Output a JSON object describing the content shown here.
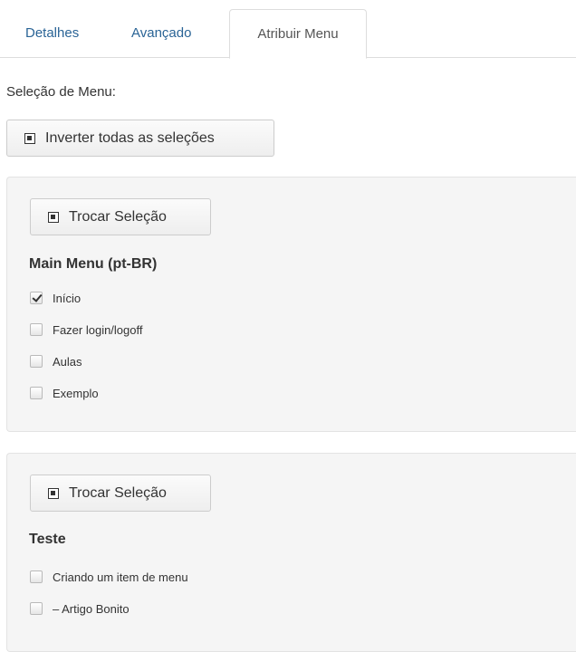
{
  "tabs": [
    {
      "label": "Detalhes",
      "active": false
    },
    {
      "label": "Avançado",
      "active": false
    },
    {
      "label": "Atribuir Menu",
      "active": true
    }
  ],
  "menu_selection": {
    "label": "Seleção de Menu:",
    "invert_button_label": "Inverter todas as seleções"
  },
  "groups": [
    {
      "toggle_label": "Trocar Seleção",
      "title": "Main Menu (pt-BR)",
      "items": [
        {
          "label": "Início",
          "checked": true
        },
        {
          "label": "Fazer login/logoff",
          "checked": false
        },
        {
          "label": "Aulas",
          "checked": false
        },
        {
          "label": "Exemplo",
          "checked": false
        }
      ]
    },
    {
      "toggle_label": "Trocar Seleção",
      "title": "Teste",
      "items": [
        {
          "label": "Criando um item de menu",
          "checked": false
        },
        {
          "label": "– Artigo Bonito",
          "checked": false
        }
      ]
    }
  ],
  "colors": {
    "link": "#2a6496",
    "well_background": "#f5f5f5",
    "border": "#dddddd"
  },
  "icons": {
    "toggle_button_icon": "square-check-icon",
    "checkbox_icon": "checkbox-icon"
  }
}
